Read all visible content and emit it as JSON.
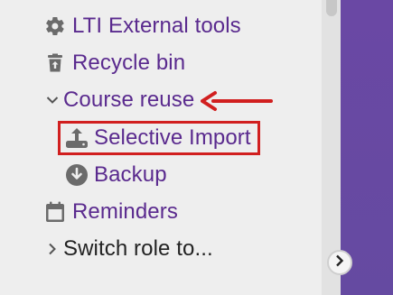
{
  "sidebar": {
    "items": [
      {
        "label": "LTI External tools",
        "icon": "gear-icon"
      },
      {
        "label": "Recycle bin",
        "icon": "trash-icon"
      },
      {
        "label": "Course reuse",
        "icon": "chevron-down-icon",
        "expanded": true
      },
      {
        "label": "Selective Import",
        "icon": "upload-icon",
        "highlighted": true
      },
      {
        "label": "Backup",
        "icon": "download-circle-icon"
      },
      {
        "label": "Reminders",
        "icon": "calendar-icon"
      },
      {
        "label": "Switch role to...",
        "icon": "chevron-right-icon"
      }
    ]
  },
  "annotation": {
    "highlight_color": "#d11f1f",
    "arrow_target": "Course reuse"
  },
  "colors": {
    "link": "#5a2a8e",
    "icon": "#6b6b6b",
    "panel_bg": "#eeeeee",
    "purple": "#6a48a4"
  },
  "collapse_button": {
    "icon": "chevron-right-icon"
  }
}
